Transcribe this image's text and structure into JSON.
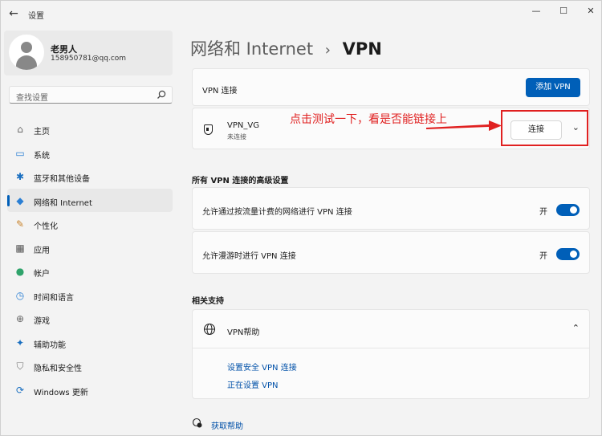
{
  "window": {
    "title": "设置",
    "back_glyph": "←",
    "min_glyph": "—",
    "max_glyph": "☐",
    "close_glyph": "✕"
  },
  "profile": {
    "name": "老男人",
    "email": "158950781@qq.com"
  },
  "search": {
    "placeholder": "查找设置",
    "icon": "search-icon"
  },
  "nav": [
    {
      "label": "主页",
      "icon": "home-icon",
      "glyph": "⌂",
      "color": "#6a6a6a"
    },
    {
      "label": "系统",
      "icon": "system-icon",
      "glyph": "▭",
      "color": "#2a7fd4"
    },
    {
      "label": "蓝牙和其他设备",
      "icon": "bluetooth-icon",
      "glyph": "✱",
      "color": "#1a6fc0"
    },
    {
      "label": "网络和 Internet",
      "icon": "wifi-icon",
      "glyph": "◆",
      "color": "#2a7fd4",
      "active": true
    },
    {
      "label": "个性化",
      "icon": "brush-icon",
      "glyph": "✎",
      "color": "#c8822a"
    },
    {
      "label": "应用",
      "icon": "apps-icon",
      "glyph": "▦",
      "color": "#555"
    },
    {
      "label": "帐户",
      "icon": "account-icon",
      "glyph": "●",
      "color": "#2fa36b"
    },
    {
      "label": "时间和语言",
      "icon": "time-language-icon",
      "glyph": "◷",
      "color": "#2a7fd4"
    },
    {
      "label": "游戏",
      "icon": "game-icon",
      "glyph": "⊕",
      "color": "#666"
    },
    {
      "label": "辅助功能",
      "icon": "accessibility-icon",
      "glyph": "✦",
      "color": "#1a6fc0"
    },
    {
      "label": "隐私和安全性",
      "icon": "privacy-shield-icon",
      "glyph": "⛉",
      "color": "#777"
    },
    {
      "label": "Windows 更新",
      "icon": "windows-update-icon",
      "glyph": "⟳",
      "color": "#1a6fc0"
    }
  ],
  "breadcrumb": {
    "parent": "网络和 Internet",
    "sep": "›",
    "current": "VPN"
  },
  "vpn": {
    "header_label": "VPN 连接",
    "add_button": "添加 VPN",
    "connection": {
      "name": "VPN_VG",
      "status": "未连接",
      "connect_button": "连接",
      "expand_glyph": "⌄"
    }
  },
  "annotation": {
    "text": "点击测试一下，看是否能链接上"
  },
  "advanced": {
    "title": "所有 VPN 连接的高级设置",
    "options": [
      {
        "label": "允许通过按流量计费的网络进行 VPN 连接",
        "state": "开",
        "on": true
      },
      {
        "label": "允许漫游时进行 VPN 连接",
        "state": "开",
        "on": true
      }
    ]
  },
  "support": {
    "title": "相关支持",
    "help_title": "VPN帮助",
    "collapse_glyph": "⌃",
    "links": [
      "设置安全 VPN 连接",
      "正在设置 VPN"
    ]
  },
  "get_help": "获取帮助"
}
